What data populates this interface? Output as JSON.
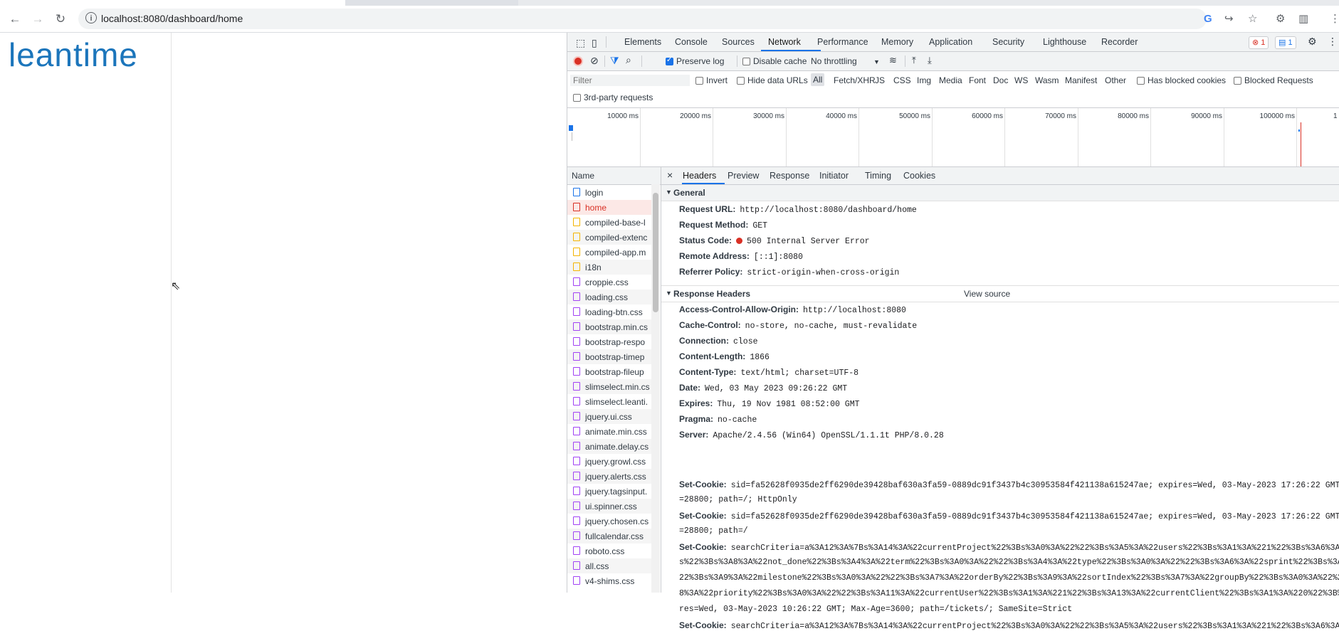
{
  "browser": {
    "url": "localhost:8080/dashboard/home"
  },
  "page": {
    "logo_text": "leantime"
  },
  "devtools": {
    "tabs": [
      "Elements",
      "Console",
      "Sources",
      "Network",
      "Performance",
      "Memory",
      "Application",
      "Security",
      "Lighthouse",
      "Recorder"
    ],
    "active_tab": "Network",
    "error_count": "1",
    "message_count": "1",
    "toolbar": {
      "preserve_log": "Preserve log",
      "disable_cache": "Disable cache",
      "throttling": "No throttling"
    },
    "filter": {
      "placeholder": "Filter",
      "invert": "Invert",
      "hide_data_urls": "Hide data URLs",
      "types": [
        "All",
        "Fetch/XHR",
        "JS",
        "CSS",
        "Img",
        "Media",
        "Font",
        "Doc",
        "WS",
        "Wasm",
        "Manifest",
        "Other"
      ],
      "has_blocked_cookies": "Has blocked cookies",
      "blocked_requests": "Blocked Requests",
      "third_party": "3rd-party requests"
    },
    "timeline_ticks": [
      "10000 ms",
      "20000 ms",
      "30000 ms",
      "40000 ms",
      "50000 ms",
      "60000 ms",
      "70000 ms",
      "80000 ms",
      "90000 ms",
      "100000 ms",
      "1"
    ],
    "name_header": "Name",
    "requests": [
      {
        "name": "login",
        "type": "doc"
      },
      {
        "name": "home",
        "type": "doc-error"
      },
      {
        "name": "compiled-base-l",
        "type": "js"
      },
      {
        "name": "compiled-extenc",
        "type": "js"
      },
      {
        "name": "compiled-app.m",
        "type": "js"
      },
      {
        "name": "i18n",
        "type": "js"
      },
      {
        "name": "croppie.css",
        "type": "css"
      },
      {
        "name": "loading.css",
        "type": "css"
      },
      {
        "name": "loading-btn.css",
        "type": "css"
      },
      {
        "name": "bootstrap.min.cs",
        "type": "css"
      },
      {
        "name": "bootstrap-respo",
        "type": "css"
      },
      {
        "name": "bootstrap-timep",
        "type": "css"
      },
      {
        "name": "bootstrap-fileup",
        "type": "css"
      },
      {
        "name": "slimselect.min.cs",
        "type": "css"
      },
      {
        "name": "slimselect.leanti.",
        "type": "css"
      },
      {
        "name": "jquery.ui.css",
        "type": "css"
      },
      {
        "name": "animate.min.css",
        "type": "css"
      },
      {
        "name": "animate.delay.cs",
        "type": "css"
      },
      {
        "name": "jquery.growl.css",
        "type": "css"
      },
      {
        "name": "jquery.alerts.css",
        "type": "css"
      },
      {
        "name": "jquery.tagsinput.",
        "type": "css"
      },
      {
        "name": "ui.spinner.css",
        "type": "css"
      },
      {
        "name": "jquery.chosen.cs",
        "type": "css"
      },
      {
        "name": "fullcalendar.css",
        "type": "css"
      },
      {
        "name": "roboto.css",
        "type": "css"
      },
      {
        "name": "all.css",
        "type": "css"
      },
      {
        "name": "v4-shims.css",
        "type": "css"
      }
    ],
    "detail": {
      "close": "×",
      "tabs": [
        "Headers",
        "Preview",
        "Response",
        "Initiator",
        "Timing",
        "Cookies"
      ],
      "general_title": "General",
      "general": [
        {
          "k": "Request URL:",
          "v": "http://localhost:8080/dashboard/home"
        },
        {
          "k": "Request Method:",
          "v": "GET"
        },
        {
          "k": "Status Code:",
          "v": "500 Internal Server Error"
        },
        {
          "k": "Remote Address:",
          "v": "[::1]:8080"
        },
        {
          "k": "Referrer Policy:",
          "v": "strict-origin-when-cross-origin"
        }
      ],
      "response_title": "Response Headers",
      "view_source": "View source",
      "response": [
        {
          "k": "Access-Control-Allow-Origin:",
          "v": "http://localhost:8080"
        },
        {
          "k": "Cache-Control:",
          "v": "no-store, no-cache, must-revalidate"
        },
        {
          "k": "Connection:",
          "v": "close"
        },
        {
          "k": "Content-Length:",
          "v": "1866"
        },
        {
          "k": "Content-Type:",
          "v": "text/html; charset=UTF-8"
        },
        {
          "k": "Date:",
          "v": "Wed, 03 May 2023 09:26:22 GMT"
        },
        {
          "k": "Expires:",
          "v": "Thu, 19 Nov 1981 08:52:00 GMT"
        },
        {
          "k": "Pragma:",
          "v": "no-cache"
        },
        {
          "k": "Server:",
          "v": "Apache/2.4.56 (Win64) OpenSSL/1.1.1t PHP/8.0.28"
        }
      ],
      "cookie1_key": "Set-Cookie:",
      "cookie1_l1": "sid=fa52628f0935de2ff6290de39428baf630a3fa59-0889dc91f3437b4c30953584f421138a615247ae; expires=Wed, 03-May-2023 17:26:22 GMT; Max-",
      "cookie1_l2": "=28800; path=/; HttpOnly",
      "cookie2_key": "Set-Cookie:",
      "cookie2_l1": "sid=fa52628f0935de2ff6290de39428baf630a3fa59-0889dc91f3437b4c30953584f421138a615247ae; expires=Wed, 03-May-2023 17:26:22 GMT; Max-",
      "cookie2_l2": "=28800; path=/",
      "cookie3_key": "Set-Cookie:",
      "cookie3_l1": "searchCriteria=a%3A12%3A%7Bs%3A14%3A%22currentProject%22%3Bs%3A0%3A%22%22%3Bs%3A5%3A%22users%22%3Bs%3A1%3A%221%22%3Bs%3A6%3A%22sta",
      "cookie3_l2": "s%22%3Bs%3A8%3A%22not_done%22%3Bs%3A4%3A%22term%22%3Bs%3A0%3A%22%22%3Bs%3A4%3A%22type%22%3Bs%3A0%3A%22%22%3Bs%3A6%3A%22sprint%22%3Bs%3A0%3A%",
      "cookie3_l3": "22%3Bs%3A9%3A%22milestone%22%3Bs%3A0%3A%22%22%3Bs%3A7%3A%22orderBy%22%3Bs%3A9%3A%22sortIndex%22%3Bs%3A7%3A%22groupBy%22%3Bs%3A0%3A%22%22%3Bs%",
      "cookie3_l4": "8%3A%22priority%22%3Bs%3A0%3A%22%22%3Bs%3A11%3A%22currentUser%22%3Bs%3A1%3A%221%22%3Bs%3A13%3A%22currentClient%22%3Bs%3A1%3A%220%22%3B%7D; ex",
      "cookie3_l5": "res=Wed, 03-May-2023 10:26:22 GMT; Max-Age=3600; path=/tickets/; SameSite=Strict",
      "cookie4_key": "Set-Cookie:",
      "cookie4_l1": "searchCriteria=a%3A12%3A%7Bs%3A14%3A%22currentProject%22%3Bs%3A0%3A%22%22%3Bs%3A5%3A%22users%22%3Bs%3A1%3A%221%22%3Bs%3A6%3A%22sta"
    },
    "colors": {
      "accent": "#1a73e8",
      "error": "#d93025",
      "record": "#d93025",
      "logo": "#1b75bb"
    }
  }
}
